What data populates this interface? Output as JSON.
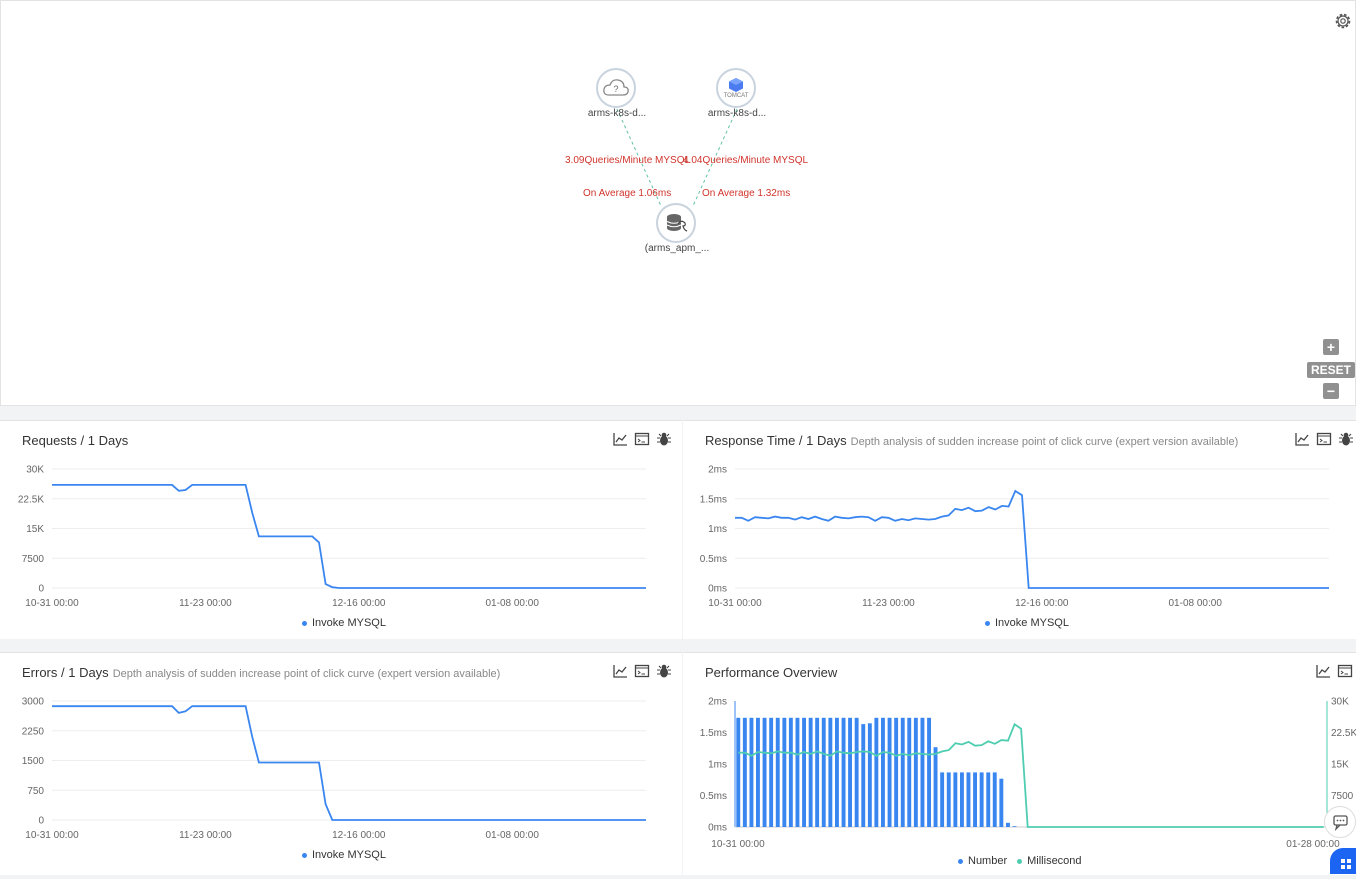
{
  "topology": {
    "nodes": [
      {
        "label": "arms-k8s-d...",
        "icon": "cloud-question-icon"
      },
      {
        "label": "arms-k8s-d...",
        "icon": "tomcat-icon",
        "icon_text": "TOMCAT"
      },
      {
        "label": "(arms_apm_...",
        "icon": "database-icon"
      }
    ],
    "edges": [
      {
        "rate": "3.09Queries/Minute MYSQL",
        "avg": "On Average 1.06ms"
      },
      {
        "rate": "4.04Queries/Minute MYSQL",
        "avg": "On Average 1.32ms"
      }
    ],
    "controls": {
      "reset_label": "RESET",
      "zoom_in": "+",
      "zoom_out": "−"
    }
  },
  "panels": {
    "requests": {
      "title": "Requests / 1 Days",
      "subtitle": "",
      "legend": "Invoke MYSQL"
    },
    "response_time": {
      "title": "Response Time / 1 Days",
      "subtitle": "Depth analysis of sudden increase point of click curve (expert version available)",
      "legend": "Invoke MYSQL"
    },
    "errors": {
      "title": "Errors / 1 Days",
      "subtitle": "Depth analysis of sudden increase point of click curve (expert version available)",
      "legend": "Invoke MYSQL"
    },
    "performance": {
      "title": "Performance Overview",
      "legend_number": "Number",
      "legend_ms": "Millisecond"
    }
  },
  "colors": {
    "line": "#3a86f0",
    "bar": "#3a86f0",
    "teal": "#4ecdb0",
    "edge_text": "#d0342c"
  },
  "chart_data": [
    {
      "type": "line",
      "title": "Requests / 1 Days",
      "series": [
        {
          "name": "Invoke MYSQL",
          "x": [
            0,
            1,
            2,
            3,
            4,
            5,
            6,
            7,
            8,
            9,
            10,
            11,
            12,
            13,
            14,
            15,
            16,
            17,
            18,
            19,
            20,
            21,
            22,
            23,
            24,
            25,
            26,
            27,
            28,
            29,
            30,
            31,
            32,
            33,
            34,
            35,
            36,
            37,
            38,
            39,
            40,
            41,
            42,
            43,
            44,
            45,
            46,
            47,
            48,
            49,
            50,
            51,
            52,
            53,
            54,
            55,
            56,
            57,
            58,
            59,
            60,
            61,
            62,
            63,
            64,
            65,
            66,
            67,
            68,
            69,
            70,
            71,
            72,
            73,
            74,
            75,
            76,
            77,
            78,
            79,
            80,
            81,
            82,
            83,
            84,
            85,
            86,
            87,
            88,
            89
          ],
          "values": [
            26000,
            26000,
            26000,
            26000,
            26000,
            26000,
            26000,
            26000,
            26000,
            26000,
            26000,
            26000,
            26000,
            26000,
            26000,
            26000,
            26000,
            26000,
            26000,
            24500,
            24700,
            26000,
            26000,
            26000,
            26000,
            26000,
            26000,
            26000,
            26000,
            26000,
            19000,
            13000,
            13000,
            13000,
            13000,
            13000,
            13000,
            13000,
            13000,
            13000,
            11500,
            1000,
            200,
            0,
            0,
            0,
            0,
            0,
            0,
            0,
            0,
            0,
            0,
            0,
            0,
            0,
            0,
            0,
            0,
            0,
            0,
            0,
            0,
            0,
            0,
            0,
            0,
            0,
            0,
            0,
            0,
            0,
            0,
            0,
            0,
            0,
            0,
            0,
            0,
            0,
            0,
            0,
            0,
            0,
            0,
            0,
            0,
            0,
            0,
            0
          ]
        }
      ],
      "x_ticks": [
        "10-31 00:00",
        "11-23 00:00",
        "12-16 00:00",
        "01-08 00:00"
      ],
      "y_ticks": [
        "30K",
        "22.5K",
        "15K",
        "7500",
        "0"
      ],
      "ylim": [
        0,
        30000
      ]
    },
    {
      "type": "line",
      "title": "Response Time / 1 Days",
      "series": [
        {
          "name": "Invoke MYSQL",
          "x": [
            0,
            1,
            2,
            3,
            4,
            5,
            6,
            7,
            8,
            9,
            10,
            11,
            12,
            13,
            14,
            15,
            16,
            17,
            18,
            19,
            20,
            21,
            22,
            23,
            24,
            25,
            26,
            27,
            28,
            29,
            30,
            31,
            32,
            33,
            34,
            35,
            36,
            37,
            38,
            39,
            40,
            41,
            42,
            43,
            44,
            45,
            46,
            47,
            48,
            49,
            50,
            51,
            52,
            53,
            54,
            55,
            56,
            57,
            58,
            59,
            60,
            61,
            62,
            63,
            64,
            65,
            66,
            67,
            68,
            69,
            70,
            71,
            72,
            73,
            74,
            75,
            76,
            77,
            78,
            79,
            80,
            81,
            82,
            83,
            84,
            85,
            86,
            87,
            88,
            89
          ],
          "values": [
            1.18,
            1.18,
            1.13,
            1.19,
            1.18,
            1.17,
            1.2,
            1.18,
            1.18,
            1.15,
            1.19,
            1.16,
            1.2,
            1.16,
            1.13,
            1.2,
            1.18,
            1.17,
            1.19,
            1.2,
            1.19,
            1.13,
            1.19,
            1.18,
            1.13,
            1.16,
            1.14,
            1.17,
            1.16,
            1.15,
            1.16,
            1.2,
            1.22,
            1.33,
            1.31,
            1.35,
            1.29,
            1.3,
            1.36,
            1.32,
            1.38,
            1.37,
            1.63,
            1.56,
            0,
            0,
            0,
            0,
            0,
            0,
            0,
            0,
            0,
            0,
            0,
            0,
            0,
            0,
            0,
            0,
            0,
            0,
            0,
            0,
            0,
            0,
            0,
            0,
            0,
            0,
            0,
            0,
            0,
            0,
            0,
            0,
            0,
            0,
            0,
            0,
            0,
            0,
            0,
            0,
            0,
            0,
            0,
            0,
            0,
            0
          ]
        }
      ],
      "x_ticks": [
        "10-31 00:00",
        "11-23 00:00",
        "12-16 00:00",
        "01-08 00:00"
      ],
      "y_ticks": [
        "2ms",
        "1.5ms",
        "1ms",
        "0.5ms",
        "0ms"
      ],
      "ylim": [
        0,
        2
      ]
    },
    {
      "type": "line",
      "title": "Errors / 1 Days",
      "series": [
        {
          "name": "Invoke MYSQL",
          "x": [
            0,
            1,
            2,
            3,
            4,
            5,
            6,
            7,
            8,
            9,
            10,
            11,
            12,
            13,
            14,
            15,
            16,
            17,
            18,
            19,
            20,
            21,
            22,
            23,
            24,
            25,
            26,
            27,
            28,
            29,
            30,
            31,
            32,
            33,
            34,
            35,
            36,
            37,
            38,
            39,
            40,
            41,
            42,
            43,
            44,
            45,
            46,
            47,
            48,
            49,
            50,
            51,
            52,
            53,
            54,
            55,
            56,
            57,
            58,
            59,
            60,
            61,
            62,
            63,
            64,
            65,
            66,
            67,
            68,
            69,
            70,
            71,
            72,
            73,
            74,
            75,
            76,
            77,
            78,
            79,
            80,
            81,
            82,
            83,
            84,
            85,
            86,
            87,
            88,
            89
          ],
          "values": [
            2870,
            2870,
            2870,
            2870,
            2870,
            2870,
            2870,
            2870,
            2870,
            2870,
            2870,
            2870,
            2870,
            2870,
            2870,
            2870,
            2870,
            2870,
            2870,
            2700,
            2740,
            2870,
            2870,
            2870,
            2870,
            2870,
            2870,
            2870,
            2870,
            2870,
            2100,
            1450,
            1450,
            1450,
            1450,
            1450,
            1450,
            1450,
            1450,
            1450,
            1450,
            400,
            0,
            0,
            0,
            0,
            0,
            0,
            0,
            0,
            0,
            0,
            0,
            0,
            0,
            0,
            0,
            0,
            0,
            0,
            0,
            0,
            0,
            0,
            0,
            0,
            0,
            0,
            0,
            0,
            0,
            0,
            0,
            0,
            0,
            0,
            0,
            0,
            0,
            0,
            0,
            0,
            0,
            0,
            0,
            0,
            0,
            0,
            0,
            0
          ]
        }
      ],
      "x_ticks": [
        "10-31 00:00",
        "11-23 00:00",
        "12-16 00:00",
        "01-08 00:00"
      ],
      "y_ticks": [
        "3000",
        "2250",
        "1500",
        "750",
        "0"
      ],
      "ylim": [
        0,
        3000
      ]
    },
    {
      "type": "bar",
      "title": "Performance Overview",
      "series": [
        {
          "name": "Number",
          "axis": "right",
          "values": [
            26000,
            26000,
            26000,
            26000,
            26000,
            26000,
            26000,
            26000,
            26000,
            26000,
            26000,
            26000,
            26000,
            26000,
            26000,
            26000,
            26000,
            26000,
            26000,
            24500,
            24700,
            26000,
            26000,
            26000,
            26000,
            26000,
            26000,
            26000,
            26000,
            26000,
            19000,
            13000,
            13000,
            13000,
            13000,
            13000,
            13000,
            13000,
            13000,
            13000,
            11500,
            1000,
            200,
            0,
            0,
            0,
            0,
            0,
            0,
            0,
            0,
            0,
            0,
            0,
            0,
            0,
            0,
            0,
            0,
            0,
            0,
            0,
            0,
            0,
            0,
            0,
            0,
            0,
            0,
            0,
            0,
            0,
            0,
            0,
            0,
            0,
            0,
            0,
            0,
            0,
            0,
            0,
            0,
            0,
            0,
            0,
            0,
            0,
            0,
            0
          ]
        },
        {
          "name": "Millisecond",
          "axis": "left",
          "values": [
            1.18,
            1.18,
            1.13,
            1.19,
            1.18,
            1.17,
            1.2,
            1.18,
            1.18,
            1.15,
            1.19,
            1.16,
            1.2,
            1.16,
            1.13,
            1.2,
            1.18,
            1.17,
            1.19,
            1.2,
            1.19,
            1.13,
            1.19,
            1.18,
            1.13,
            1.16,
            1.14,
            1.17,
            1.16,
            1.15,
            1.16,
            1.2,
            1.22,
            1.33,
            1.31,
            1.35,
            1.29,
            1.3,
            1.36,
            1.32,
            1.38,
            1.37,
            1.63,
            1.56,
            0,
            0,
            0,
            0,
            0,
            0,
            0,
            0,
            0,
            0,
            0,
            0,
            0,
            0,
            0,
            0,
            0,
            0,
            0,
            0,
            0,
            0,
            0,
            0,
            0,
            0,
            0,
            0,
            0,
            0,
            0,
            0,
            0,
            0,
            0,
            0,
            0,
            0,
            0,
            0,
            0,
            0,
            0,
            0,
            0,
            0
          ]
        }
      ],
      "x_ticks": [
        "10-31 00:00",
        "01-28 00:00"
      ],
      "y_ticks_left": [
        "2ms",
        "1.5ms",
        "1ms",
        "0.5ms",
        "0ms"
      ],
      "y_ticks_right": [
        "30K",
        "22.5K",
        "15K",
        "7500",
        "0"
      ],
      "ylim_left": [
        0,
        2
      ],
      "ylim_right": [
        0,
        30000
      ]
    }
  ]
}
